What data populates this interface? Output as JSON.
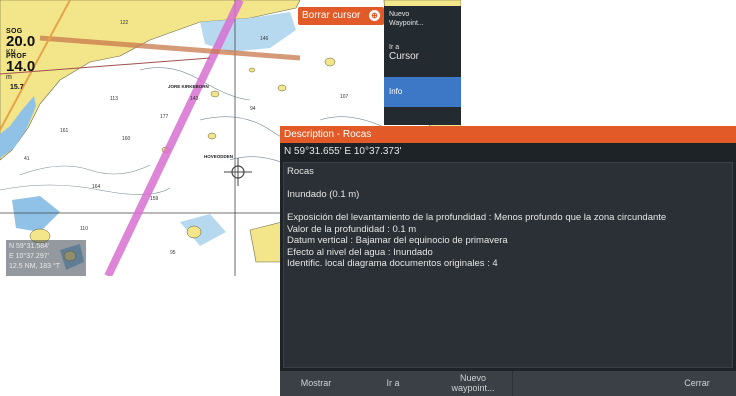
{
  "chart": {
    "hud_speed": {
      "label": "SOG",
      "value": "20.0",
      "unit": "KN"
    },
    "hud_depth": {
      "label": "PROF",
      "value": "14.0",
      "unit": "m"
    },
    "hud_extra": "15.7",
    "coords": {
      "lat": "N 59°31.584'",
      "lon": "E 10°37.297'",
      "range": "12.5 NM, 183 °T"
    },
    "place_labels": [
      "JORE KIRKEBORN",
      "HOVEODDEN"
    ]
  },
  "borrar_cursor": {
    "label": "Borrar cursor",
    "icon": "cursor-icon"
  },
  "side_menu": {
    "nuevo_waypoint": [
      "Nuevo",
      "Waypoint..."
    ],
    "ir_a": {
      "small": "Ir a",
      "big": "Cursor"
    },
    "info": "Info"
  },
  "dialog": {
    "title": "Description - Rocas",
    "coords": "N  59°31.655'  E  10°37.373'",
    "lines": [
      "Rocas",
      "",
      "Inundado (0.1 m)",
      "",
      "Exposición del levantamiento de la profundidad : Menos profundo que la zona circundante",
      "Valor de la profundidad : 0.1 m",
      "Datum vertical : Bajamar del equinocio de primavera",
      "Efecto al nivel del agua : Inundado",
      "Identific. local diagrama documentos originales : 4"
    ],
    "footer": {
      "mostrar": "Mostrar",
      "ir_a": "Ir a",
      "nuevo_waypoint": [
        "Nuevo",
        "waypoint..."
      ],
      "cerrar": "Cerrar"
    }
  },
  "colors": {
    "accent": "#e15a28",
    "selected": "#3c78c6",
    "dialog_bg": "#1e2327",
    "land": "#f3e58a",
    "water": "#ffffff"
  }
}
